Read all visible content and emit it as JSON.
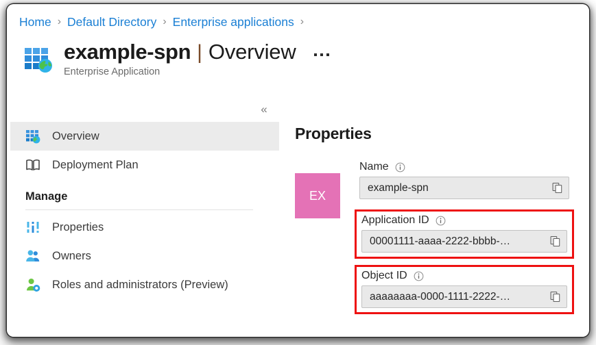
{
  "breadcrumb": {
    "items": [
      {
        "label": "Home"
      },
      {
        "label": "Default Directory"
      },
      {
        "label": "Enterprise applications"
      }
    ],
    "separator": "›"
  },
  "header": {
    "icon": "enterprise-application-icon",
    "app_name": "example-spn",
    "pipe": "|",
    "page_name": "Overview",
    "subtitle": "Enterprise Application",
    "more_menu": "…"
  },
  "sidebar": {
    "collapse_glyph": "«",
    "items": [
      {
        "label": "Overview",
        "icon": "grid-globe-icon",
        "selected": true
      },
      {
        "label": "Deployment Plan",
        "icon": "book-icon",
        "selected": false
      }
    ],
    "manage": {
      "header": "Manage",
      "items": [
        {
          "label": "Properties",
          "icon": "sliders-icon",
          "selected": false
        },
        {
          "label": "Owners",
          "icon": "people-icon",
          "selected": false
        },
        {
          "label": "Roles and administrators (Preview)",
          "icon": "person-badge-icon",
          "selected": false
        }
      ]
    }
  },
  "properties": {
    "title": "Properties",
    "avatar_initials": "EX",
    "avatar_color": "#e472b6",
    "highlight_color": "#ee1111",
    "fields": [
      {
        "label": "Name",
        "value": "example-spn",
        "highlighted": false,
        "info": "info-icon",
        "copy": "copy-icon"
      },
      {
        "label": "Application ID",
        "value": "00001111-aaaa-2222-bbbb-…",
        "highlighted": true,
        "info": "info-icon",
        "copy": "copy-icon"
      },
      {
        "label": "Object ID",
        "value": "aaaaaaaa-0000-1111-2222-…",
        "highlighted": true,
        "info": "info-icon",
        "copy": "copy-icon"
      }
    ]
  }
}
